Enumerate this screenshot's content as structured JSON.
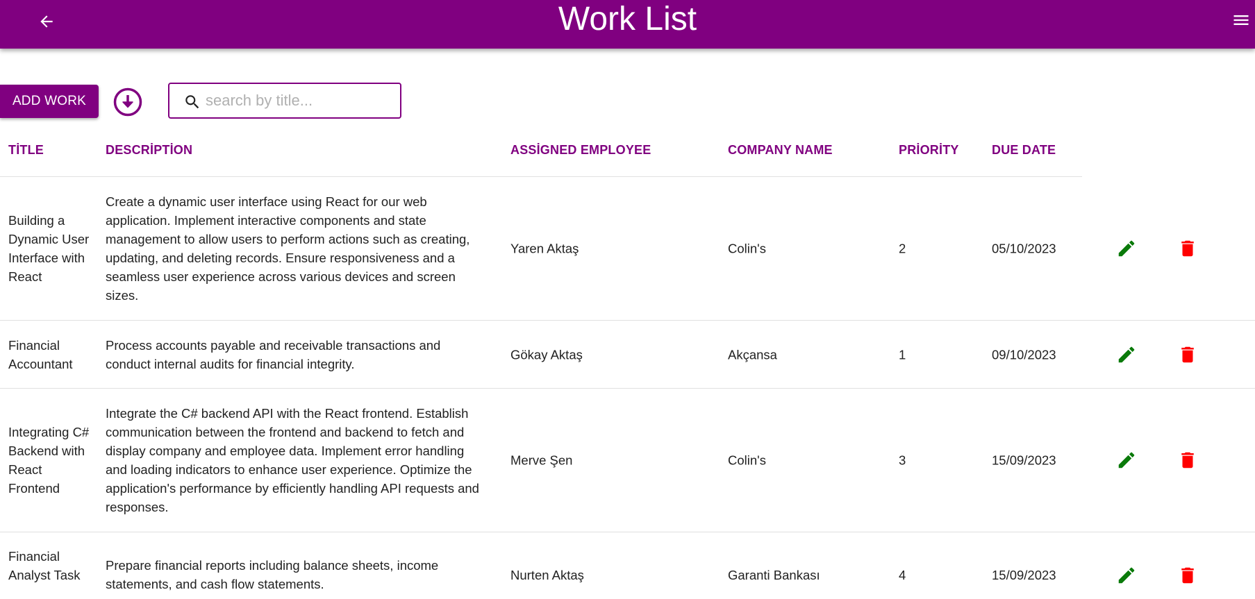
{
  "appbar": {
    "title": "Work List",
    "back_icon": "arrow-left-icon",
    "menu_icon": "hamburger-menu-icon",
    "color": "#800080"
  },
  "toolbar": {
    "add_label": "ADD WORK",
    "download_icon": "download-circle-icon",
    "search_placeholder": "search by title...",
    "search_value": ""
  },
  "table": {
    "columns": [
      "TİTLE",
      "DESCRİPTİON",
      "ASSİGNED EMPLOYEE",
      "COMPANY NAME",
      "PRİORİTY",
      "DUE DATE"
    ],
    "rows": [
      {
        "title": "Building a Dynamic User Interface with React",
        "description": "Create a dynamic user interface using React for our web application. Implement interactive components and state management to allow users to perform actions such as creating, updating, and deleting records. Ensure responsiveness and a seamless user experience across various devices and screen sizes.",
        "employee": "Yaren Aktaş",
        "company": "Colin's",
        "priority": "2",
        "due_date": "05/10/2023"
      },
      {
        "title": "Financial Accountant",
        "description": "Process accounts payable and receivable transactions and conduct internal audits for financial integrity.",
        "employee": "Gökay Aktaş",
        "company": "Akçansa",
        "priority": "1",
        "due_date": "09/10/2023"
      },
      {
        "title": "Integrating C# Backend with React Frontend",
        "description": "Integrate the C# backend API with the React frontend. Establish communication between the frontend and backend to fetch and display company and employee data. Implement error handling and loading indicators to enhance user experience. Optimize the application's performance by efficiently handling API requests and responses.",
        "employee": "Merve Şen",
        "company": "Colin's",
        "priority": "3",
        "due_date": "15/09/2023"
      },
      {
        "title": "Financial Analyst Task",
        "description": "Prepare financial reports including balance sheets, income statements, and cash flow statements.",
        "employee": "Nurten Aktaş",
        "company": "Garanti Bankası",
        "priority": "4",
        "due_date": "15/09/2023"
      }
    ],
    "edit_icon": "pencil-edit-icon",
    "delete_icon": "trash-delete-icon",
    "edit_color": "#0a7a0a",
    "delete_color": "#ff0000",
    "header_color": "#800080"
  }
}
